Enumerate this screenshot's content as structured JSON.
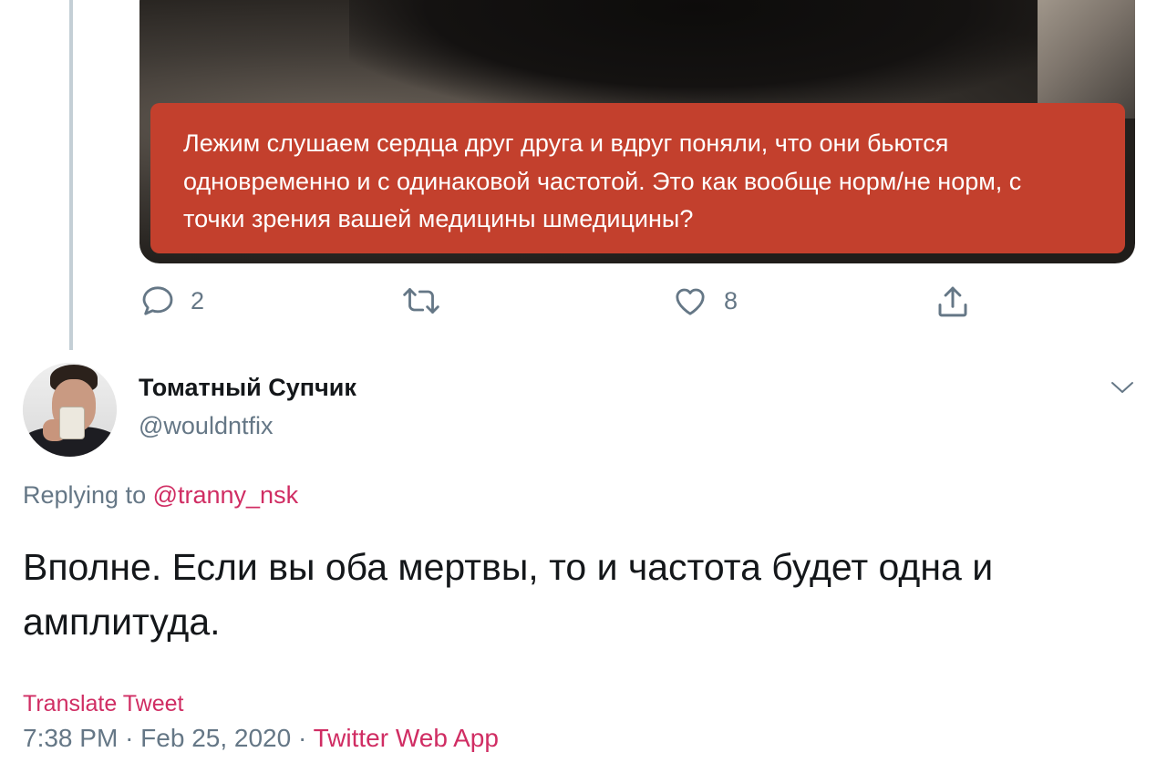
{
  "quoted_tweet": {
    "caption": "Лежим слушаем сердца друг друга и вдруг поняли, что они бьются одновременно и с одинаковой частотой. Это как вообще норм/не норм, с точки зрения вашей медицины шмедицины?",
    "actions": {
      "replies": "2",
      "retweets": "",
      "likes": "8"
    }
  },
  "tweet": {
    "author_name": "Томатный Супчик",
    "author_handle": "@wouldntfix",
    "replying_prefix": "Replying to ",
    "replying_mention": "@tranny_nsk",
    "text": "Вполне. Если вы оба мертвы, то и частота будет одна и амплитуда.",
    "translate_label": "Translate Tweet",
    "time": "7:38 PM",
    "date": "Feb 25, 2020",
    "separator": "·",
    "source_app": "Twitter Web App"
  },
  "colors": {
    "accent": "#d02d63",
    "caption_bg": "#c3402d",
    "secondary_text": "#657786",
    "thread_line": "#c4cfd6"
  },
  "icons": [
    "reply-icon",
    "retweet-icon",
    "like-icon",
    "share-icon",
    "chevron-down-icon"
  ]
}
